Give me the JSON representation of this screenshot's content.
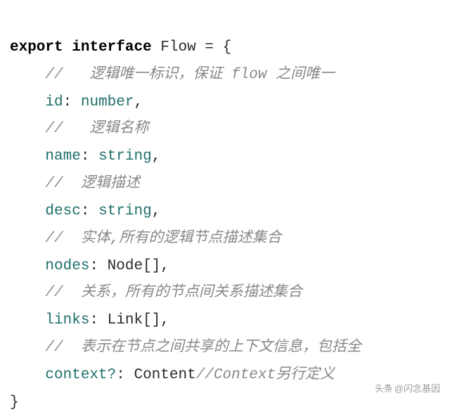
{
  "code": {
    "line1": {
      "kw1": "export",
      "kw2": "interface",
      "name": "Flow",
      "eq": "=",
      "brace": "{"
    },
    "line2_comment": "//   逻辑唯一标识，保证 flow 之间唯一",
    "line3": {
      "prop": "id",
      "colon": ":",
      "type": "number",
      "comma": ","
    },
    "line4_comment": "//   逻辑名称",
    "line5": {
      "prop": "name",
      "colon": ":",
      "type": "string",
      "comma": ","
    },
    "line6_comment": "//  逻辑描述",
    "line7": {
      "prop": "desc",
      "colon": ":",
      "type": "string",
      "comma": ","
    },
    "line8_comment": "//  实体,所有的逻辑节点描述集合",
    "line9": {
      "prop": "nodes",
      "colon": ":",
      "type": "Node[]",
      "comma": ","
    },
    "line10_comment": "//  关系，所有的节点间关系描述集合",
    "line11": {
      "prop": "links",
      "colon": ":",
      "type": "Link[]",
      "comma": ","
    },
    "line12_comment": "//  表示在节点之间共享的上下文信息，包括全",
    "line13": {
      "prop": "context?",
      "colon": ":",
      "type": "Content",
      "trail_comment": "//Context另行定义"
    },
    "line14_brace": "}"
  },
  "watermark": {
    "icon": "头条",
    "text": "@闪念基因"
  }
}
